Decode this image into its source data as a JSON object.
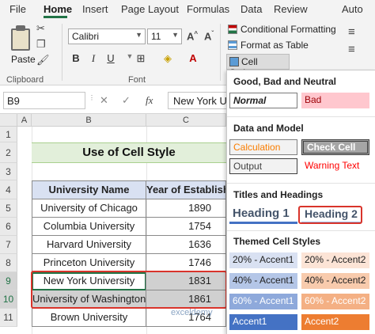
{
  "ribbon": {
    "tabs": [
      "File",
      "Home",
      "Insert",
      "Page Layout",
      "Formulas",
      "Data",
      "Review",
      "Auto"
    ],
    "active_tab": "Home",
    "clipboard": {
      "paste_label": "Paste",
      "group_label": "Clipboard"
    },
    "font": {
      "name": "Calibri",
      "size": "11",
      "group_label": "Font"
    },
    "styles": {
      "conditional_formatting": "Conditional Formatting",
      "format_as_table": "Format as Table",
      "cell_styles": "Cell Styles"
    }
  },
  "formula_bar": {
    "name_box": "B9",
    "fx": "fx",
    "content": "New York University"
  },
  "sheet": {
    "columns": [
      "A",
      "B",
      "C"
    ],
    "rows": [
      "1",
      "2",
      "3",
      "4",
      "5",
      "6",
      "7",
      "8",
      "9",
      "10",
      "11"
    ],
    "title": "Use of Cell Style",
    "table": {
      "headers": [
        "University Name",
        "Year of Establish"
      ],
      "rows": [
        [
          "University of Chicago",
          "1890"
        ],
        [
          "Columbia University",
          "1754"
        ],
        [
          "Harvard University",
          "1636"
        ],
        [
          "Princeton University",
          "1746"
        ],
        [
          "New York University",
          "1831"
        ],
        [
          "University of Washington",
          "1861"
        ],
        [
          "Brown University",
          "1764"
        ]
      ]
    },
    "watermark": "exceldemy"
  },
  "cell_styles": {
    "good_bad_neutral": {
      "title": "Good, Bad and Neutral",
      "normal": "Normal",
      "bad": "Bad"
    },
    "data_model": {
      "title": "Data and Model",
      "calculation": "Calculation",
      "check_cell": "Check Cell",
      "output": "Output",
      "warning": "Warning Text"
    },
    "titles_headings": {
      "title": "Titles and Headings",
      "heading1": "Heading 1",
      "heading2": "Heading 2"
    },
    "themed": {
      "title": "Themed Cell Styles",
      "items": [
        "20% - Accent1",
        "20% - Accent2",
        "40% - Accent1",
        "40% - Accent2",
        "60% - Accent1",
        "60% - Accent2",
        "Accent1",
        "Accent2"
      ]
    }
  },
  "colors": {
    "excel_green": "#217346",
    "highlight_red": "#d9342b",
    "header_fill": "#d9e1f2",
    "title_fill": "#e2efda"
  }
}
